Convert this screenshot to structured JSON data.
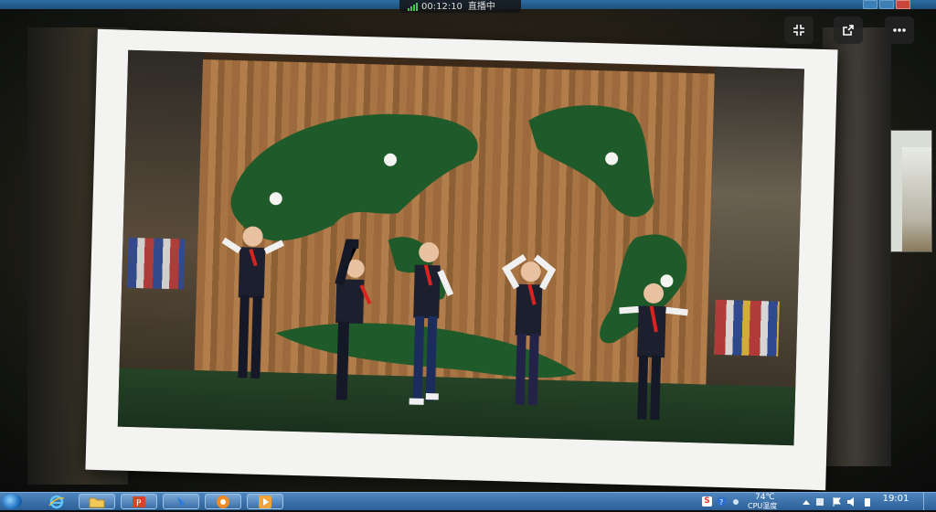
{
  "live_bar": {
    "elapsed": "00:12:10",
    "status": "直播中"
  },
  "top_buttons": [
    "fullscreen-exit-icon",
    "share-icon",
    "more-icon"
  ],
  "taskbar": {
    "apps": [
      "internet-explorer-icon",
      "folder-icon",
      "powerpoint-icon",
      "pen-tool-icon",
      "settings-app-icon",
      "media-player-icon"
    ],
    "tray": {
      "ime": "S",
      "temperature": "74℃",
      "cpu_label": "CPU温度",
      "time": "19:01"
    }
  },
  "colors": {
    "taskbar": "#2c5f96",
    "signal": "#3cc84a",
    "frame": "#f3f3f1",
    "scarf": "#d8231f"
  }
}
